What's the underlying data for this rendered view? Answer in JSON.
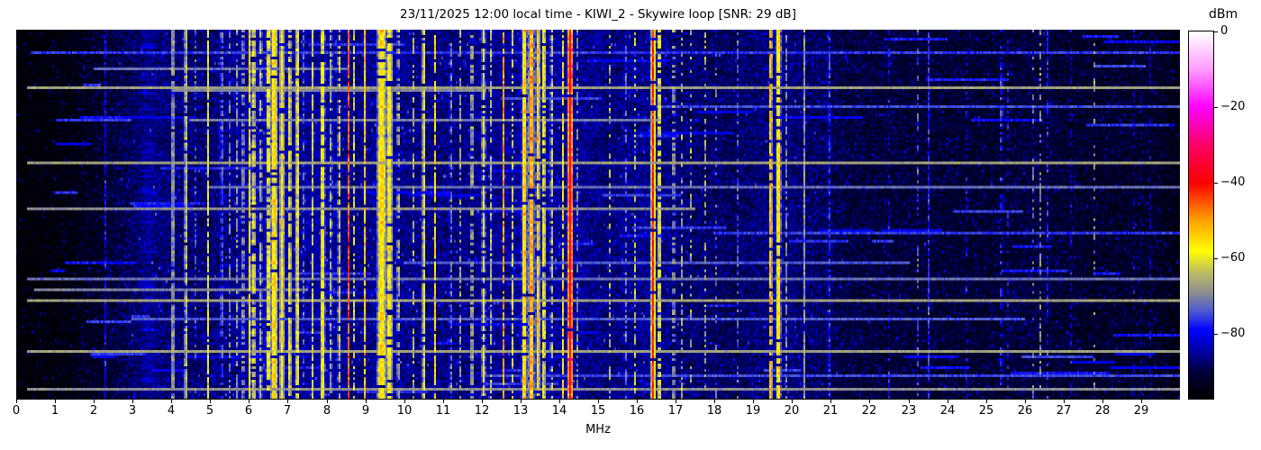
{
  "title": "23/11/2025 12:00 local time - KIWI_2 - Skywire loop [SNR: 29 dB]",
  "xaxis": {
    "label": "MHz",
    "ticks": [
      "0",
      "1",
      "2",
      "3",
      "4",
      "5",
      "6",
      "7",
      "8",
      "9",
      "10",
      "11",
      "12",
      "13",
      "14",
      "15",
      "16",
      "17",
      "18",
      "19",
      "20",
      "21",
      "22",
      "23",
      "24",
      "25",
      "26",
      "27",
      "28",
      "29"
    ]
  },
  "colorbar": {
    "label": "dBm",
    "ticks": [
      {
        "label": "0",
        "value": 0
      },
      {
        "label": "−20",
        "value": -20
      },
      {
        "label": "−40",
        "value": -40
      },
      {
        "label": "−60",
        "value": -60
      },
      {
        "label": "−80",
        "value": -80
      }
    ],
    "vmin": -97,
    "vmax": 0
  },
  "chart_data": {
    "type": "heatmap",
    "title": "23/11/2025 12:00 local time - KIWI_2 - Skywire loop [SNR: 29 dB]",
    "xlabel": "MHz",
    "ylabel": "",
    "x_range": [
      0,
      30
    ],
    "value_unit": "dBm",
    "value_range": [
      -97,
      0
    ],
    "legend_position": "right-colorbar",
    "grid": false,
    "colormap_stops": [
      [
        0.0,
        "#000000"
      ],
      [
        0.072,
        "#00003c"
      ],
      [
        0.134,
        "#0000b0"
      ],
      [
        0.186,
        "#0000ff"
      ],
      [
        0.237,
        "#4b5ad2"
      ],
      [
        0.289,
        "#8e8e8e"
      ],
      [
        0.34,
        "#b9b968"
      ],
      [
        0.402,
        "#ffff00"
      ],
      [
        0.485,
        "#ffa200"
      ],
      [
        0.588,
        "#ff0000"
      ],
      [
        0.691,
        "#ff0066"
      ],
      [
        0.794,
        "#ff00ff"
      ],
      [
        0.897,
        "#ff9bff"
      ],
      [
        1.0,
        "#ffffff"
      ]
    ],
    "noise_floor_dbm": [
      [
        0,
        -97
      ],
      [
        1.2,
        -95.5
      ],
      [
        2.2,
        -92
      ],
      [
        3.0,
        -88.5
      ],
      [
        3.6,
        -87
      ],
      [
        4.4,
        -87.5
      ],
      [
        5.2,
        -87
      ],
      [
        5.8,
        -85.5
      ],
      [
        7.0,
        -85
      ],
      [
        8.2,
        -85.5
      ],
      [
        8.8,
        -86.5
      ],
      [
        9.5,
        -85
      ],
      [
        10.3,
        -86.5
      ],
      [
        11.2,
        -86.5
      ],
      [
        12.3,
        -86
      ],
      [
        13.3,
        -85
      ],
      [
        14.4,
        -85.5
      ],
      [
        15.2,
        -87
      ],
      [
        16.4,
        -85.5
      ],
      [
        17.2,
        -87.5
      ],
      [
        18.5,
        -88.5
      ],
      [
        19.6,
        -86.5
      ],
      [
        20.6,
        -88
      ],
      [
        21.5,
        -90.5
      ],
      [
        23.0,
        -91
      ],
      [
        25.0,
        -91.5
      ],
      [
        26.3,
        -90.5
      ],
      [
        27.5,
        -92
      ],
      [
        29.3,
        -92
      ],
      [
        29.8,
        -94
      ],
      [
        30,
        -95
      ]
    ],
    "signals": [
      {
        "f": 2.3,
        "w": 0.015,
        "dbm": -80,
        "duty": 0.85
      },
      {
        "f": 3.4,
        "w": 0.35,
        "dbm": -86,
        "duty": 1.0
      },
      {
        "f": 4.04,
        "w": 0.025,
        "dbm": -60,
        "duty": 0.92
      },
      {
        "f": 4.37,
        "w": 0.025,
        "dbm": -58,
        "duty": 0.92
      },
      {
        "f": 4.62,
        "w": 0.015,
        "dbm": -74,
        "duty": 0.5
      },
      {
        "f": 4.95,
        "w": 0.025,
        "dbm": -59,
        "duty": 0.9
      },
      {
        "f": 5.3,
        "w": 0.04,
        "dbm": -72,
        "duty": 0.7
      },
      {
        "f": 5.5,
        "w": 0.02,
        "dbm": -70,
        "duty": 0.5
      },
      {
        "f": 5.7,
        "w": 0.03,
        "dbm": -66,
        "duty": 0.6
      },
      {
        "f": 5.85,
        "w": 0.03,
        "dbm": -64,
        "duty": 0.7
      },
      {
        "f": 6.0,
        "w": 0.018,
        "dbm": -49,
        "duty": 0.93
      },
      {
        "f": 6.12,
        "w": 0.06,
        "dbm": -62,
        "duty": 0.8
      },
      {
        "f": 6.3,
        "w": 0.04,
        "dbm": -64,
        "duty": 0.7
      },
      {
        "f": 6.5,
        "w": 0.05,
        "dbm": -58,
        "duty": 0.85
      },
      {
        "f": 6.65,
        "w": 0.07,
        "dbm": -55,
        "duty": 0.95
      },
      {
        "f": 6.85,
        "w": 0.05,
        "dbm": -57,
        "duty": 0.9
      },
      {
        "f": 7.05,
        "w": 0.04,
        "dbm": -59,
        "duty": 0.85
      },
      {
        "f": 7.25,
        "w": 0.035,
        "dbm": -57,
        "duty": 0.9
      },
      {
        "f": 7.42,
        "w": 0.02,
        "dbm": -68,
        "duty": 0.5
      },
      {
        "f": 7.65,
        "w": 0.025,
        "dbm": -60,
        "duty": 0.8
      },
      {
        "f": 7.9,
        "w": 0.05,
        "dbm": -57,
        "duty": 0.9
      },
      {
        "f": 8.12,
        "w": 0.025,
        "dbm": -61,
        "duty": 0.7
      },
      {
        "f": 8.32,
        "w": 0.025,
        "dbm": -58,
        "duty": 0.8
      },
      {
        "f": 8.57,
        "w": 0.018,
        "dbm": -46,
        "duty": 0.92
      },
      {
        "f": 8.7,
        "w": 0.02,
        "dbm": -60,
        "duty": 0.7
      },
      {
        "f": 9.0,
        "w": 0.018,
        "dbm": -47,
        "duty": 0.92
      },
      {
        "f": 9.42,
        "w": 0.09,
        "dbm": -55,
        "duty": 0.95
      },
      {
        "f": 9.62,
        "w": 0.07,
        "dbm": -57,
        "duty": 0.9
      },
      {
        "f": 9.85,
        "w": 0.03,
        "dbm": -62,
        "duty": 0.6
      },
      {
        "f": 10.25,
        "w": 0.02,
        "dbm": -62,
        "duty": 0.5
      },
      {
        "f": 10.5,
        "w": 0.02,
        "dbm": -48,
        "duty": 0.93
      },
      {
        "f": 10.8,
        "w": 0.022,
        "dbm": -55,
        "duty": 0.85
      },
      {
        "f": 11.2,
        "w": 0.03,
        "dbm": -68,
        "duty": 0.6
      },
      {
        "f": 11.45,
        "w": 0.03,
        "dbm": -67,
        "duty": 0.6
      },
      {
        "f": 11.75,
        "w": 0.03,
        "dbm": -61,
        "duty": 0.7
      },
      {
        "f": 12.05,
        "w": 0.04,
        "dbm": -59,
        "duty": 0.8
      },
      {
        "f": 12.25,
        "w": 0.025,
        "dbm": -61,
        "duty": 0.7
      },
      {
        "f": 12.55,
        "w": 0.018,
        "dbm": -45,
        "duty": 0.85
      },
      {
        "f": 12.8,
        "w": 0.03,
        "dbm": -61,
        "duty": 0.7
      },
      {
        "f": 13.1,
        "w": 0.05,
        "dbm": -53,
        "duty": 0.95
      },
      {
        "f": 13.28,
        "w": 0.05,
        "dbm": -49,
        "duty": 0.95
      },
      {
        "f": 13.45,
        "w": 0.04,
        "dbm": -55,
        "duty": 0.9
      },
      {
        "f": 13.6,
        "w": 0.04,
        "dbm": -57,
        "duty": 0.85
      },
      {
        "f": 13.8,
        "w": 0.025,
        "dbm": -59,
        "duty": 0.7
      },
      {
        "f": 14.1,
        "w": 0.025,
        "dbm": -57,
        "duty": 0.8
      },
      {
        "f": 14.28,
        "w": 0.045,
        "dbm": -36,
        "duty": 0.97
      },
      {
        "f": 14.45,
        "w": 0.018,
        "dbm": -60,
        "duty": 0.6
      },
      {
        "f": 15.0,
        "w": 0.018,
        "dbm": -67,
        "duty": 0.5
      },
      {
        "f": 15.3,
        "w": 0.025,
        "dbm": -65,
        "duty": 0.45
      },
      {
        "f": 15.7,
        "w": 0.02,
        "dbm": -60,
        "duty": 0.5
      },
      {
        "f": 15.95,
        "w": 0.022,
        "dbm": -63,
        "duty": 0.5
      },
      {
        "f": 16.42,
        "w": 0.035,
        "dbm": -41,
        "duty": 0.95
      },
      {
        "f": 16.58,
        "w": 0.025,
        "dbm": -51,
        "duty": 0.8
      },
      {
        "f": 16.95,
        "w": 0.025,
        "dbm": -60,
        "duty": 0.55
      },
      {
        "f": 17.15,
        "w": 0.02,
        "dbm": -64,
        "duty": 0.45
      },
      {
        "f": 17.4,
        "w": 0.018,
        "dbm": -63,
        "duty": 0.35
      },
      {
        "f": 17.75,
        "w": 0.022,
        "dbm": -62,
        "duty": 0.4
      },
      {
        "f": 18.05,
        "w": 0.015,
        "dbm": -68,
        "duty": 0.3
      },
      {
        "f": 18.6,
        "w": 0.015,
        "dbm": -74,
        "duty": 0.4
      },
      {
        "f": 19.45,
        "w": 0.025,
        "dbm": -49,
        "duty": 0.8
      },
      {
        "f": 19.65,
        "w": 0.05,
        "dbm": -55,
        "duty": 0.9
      },
      {
        "f": 19.87,
        "w": 0.018,
        "dbm": -59,
        "duty": 0.7
      },
      {
        "f": 20.3,
        "w": 0.016,
        "dbm": -55,
        "duty": 0.95
      },
      {
        "f": 20.62,
        "w": 0.015,
        "dbm": -76,
        "duty": 0.5
      },
      {
        "f": 20.95,
        "w": 0.03,
        "dbm": -73,
        "duty": 0.8
      },
      {
        "f": 21.97,
        "w": 0.016,
        "dbm": -77,
        "duty": 0.6
      },
      {
        "f": 22.5,
        "w": 0.015,
        "dbm": -80,
        "duty": 0.4
      },
      {
        "f": 23.26,
        "w": 0.016,
        "dbm": -61,
        "duty": 0.35
      },
      {
        "f": 23.54,
        "w": 0.014,
        "dbm": -57,
        "duty": 0.88
      },
      {
        "f": 24.5,
        "w": 0.015,
        "dbm": -80,
        "duty": 0.4
      },
      {
        "f": 25.4,
        "w": 0.025,
        "dbm": -69,
        "duty": 0.45
      },
      {
        "f": 25.58,
        "w": 0.018,
        "dbm": -71,
        "duty": 0.4
      },
      {
        "f": 26.2,
        "w": 0.016,
        "dbm": -61,
        "duty": 0.3
      },
      {
        "f": 26.4,
        "w": 0.022,
        "dbm": -69,
        "duty": 0.45
      },
      {
        "f": 26.58,
        "w": 0.016,
        "dbm": -75,
        "duty": 0.55
      },
      {
        "f": 27.2,
        "w": 0.013,
        "dbm": -74,
        "duty": 0.3
      },
      {
        "f": 27.8,
        "w": 0.013,
        "dbm": -67,
        "duty": 0.2
      },
      {
        "f": 28.8,
        "w": 0.016,
        "dbm": -69,
        "duty": 0.25
      },
      {
        "f": 29.02,
        "w": 0.016,
        "dbm": -71,
        "duty": 0.3
      },
      {
        "f": 29.22,
        "w": 0.016,
        "dbm": -73,
        "duty": 0.25
      }
    ],
    "time_events": [
      {
        "y": 0.062,
        "f0": 0.4,
        "f1": 30,
        "dbm": -76
      },
      {
        "y": 0.1,
        "f0": 2.0,
        "f1": 8.5,
        "dbm": -72
      },
      {
        "y": 0.155,
        "f0": 0.3,
        "f1": 30,
        "dbm": -67
      },
      {
        "y": 0.165,
        "f0": 4.0,
        "f1": 12,
        "dbm": -70
      },
      {
        "y": 0.205,
        "f0": 16.5,
        "f1": 30,
        "dbm": -75
      },
      {
        "y": 0.245,
        "f0": 4.5,
        "f1": 16.5,
        "dbm": -71
      },
      {
        "y": 0.36,
        "f0": 0.3,
        "f1": 30,
        "dbm": -67
      },
      {
        "y": 0.425,
        "f0": 5.0,
        "f1": 30,
        "dbm": -72
      },
      {
        "y": 0.487,
        "f0": 0.3,
        "f1": 17.5,
        "dbm": -69
      },
      {
        "y": 0.555,
        "f0": 18,
        "f1": 30,
        "dbm": -76
      },
      {
        "y": 0.63,
        "f0": 10,
        "f1": 23,
        "dbm": -74
      },
      {
        "y": 0.678,
        "f0": 0.3,
        "f1": 30,
        "dbm": -72
      },
      {
        "y": 0.705,
        "f0": 0.5,
        "f1": 7.5,
        "dbm": -70
      },
      {
        "y": 0.737,
        "f0": 0.3,
        "f1": 30,
        "dbm": -67
      },
      {
        "y": 0.79,
        "f0": 3,
        "f1": 26,
        "dbm": -74
      },
      {
        "y": 0.875,
        "f0": 0.3,
        "f1": 30,
        "dbm": -67
      },
      {
        "y": 0.94,
        "f0": 12,
        "f1": 30,
        "dbm": -75
      },
      {
        "y": 0.975,
        "f0": 0.3,
        "f1": 30,
        "dbm": -69
      }
    ],
    "random_segments": {
      "count": 80,
      "dbm_min": -81,
      "dbm_max": -75,
      "len_min": 0.3,
      "len_max": 2.5
    },
    "render": {
      "seed": 1337,
      "cols": 646,
      "rows": 137,
      "noise_sigma": 2.2,
      "speckle_prob": 0.04
    }
  }
}
